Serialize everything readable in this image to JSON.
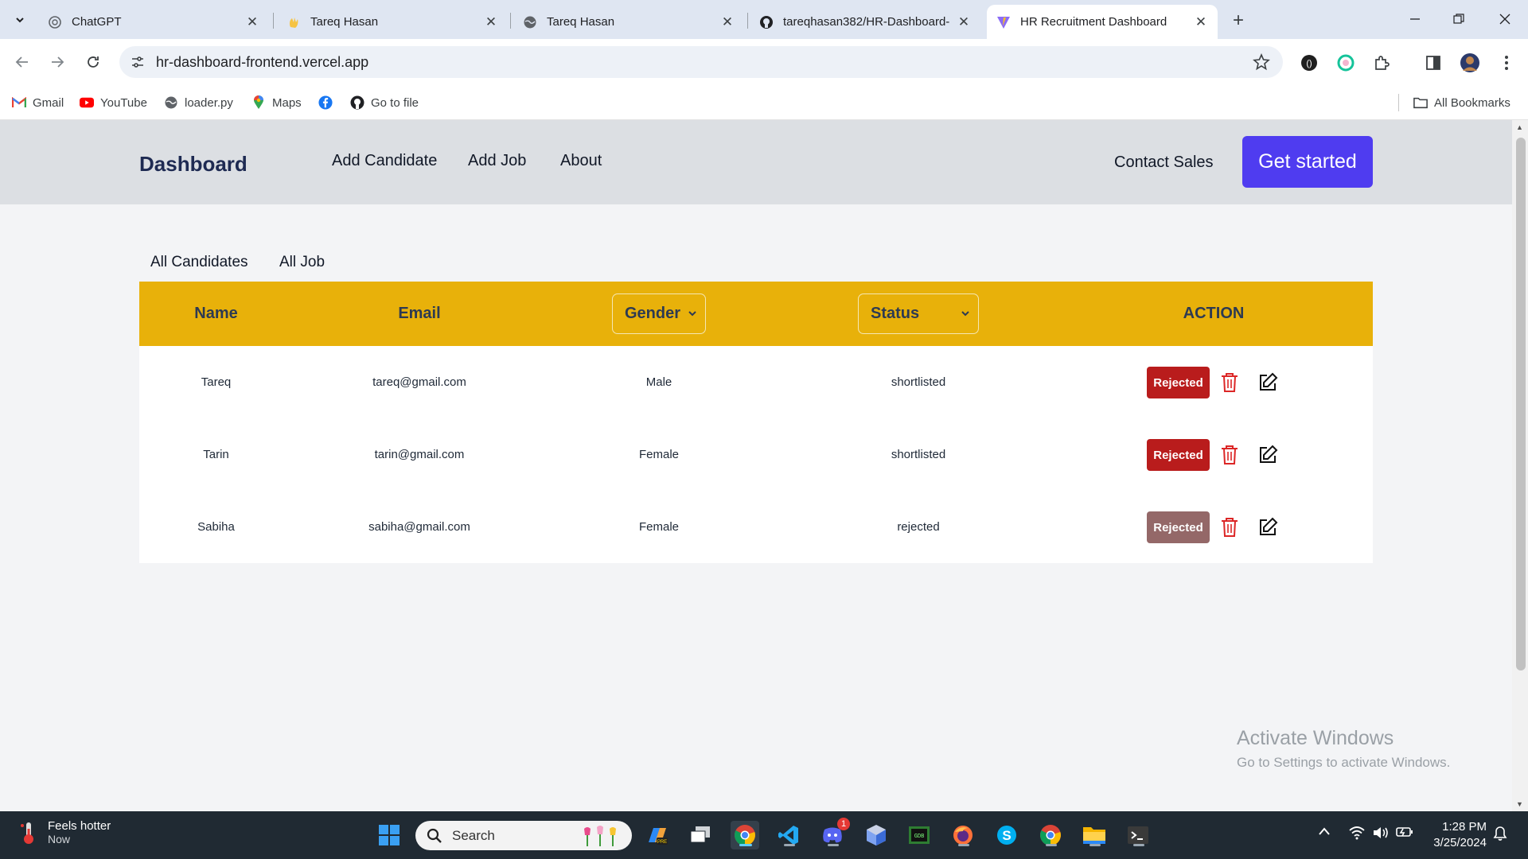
{
  "browser": {
    "tabs": [
      {
        "title": "ChatGPT",
        "icon": "chatgpt-icon",
        "active": false
      },
      {
        "title": "Tareq Hasan",
        "icon": "wave-hand-icon",
        "active": false
      },
      {
        "title": "Tareq Hasan",
        "icon": "globe-icon",
        "active": false
      },
      {
        "title": "tareqhasan382/HR-Dashboard-",
        "icon": "github-icon",
        "active": false
      },
      {
        "title": "HR Recruitment Dashboard",
        "icon": "vite-icon",
        "active": true
      }
    ],
    "url": "hr-dashboard-frontend.vercel.app",
    "bookmarks": [
      {
        "label": "Gmail",
        "icon": "gmail-icon"
      },
      {
        "label": "YouTube",
        "icon": "youtube-icon"
      },
      {
        "label": "loader.py",
        "icon": "globe-icon"
      },
      {
        "label": "Maps",
        "icon": "maps-icon"
      },
      {
        "label": "",
        "icon": "facebook-icon"
      },
      {
        "label": "Go to file",
        "icon": "github-icon"
      }
    ],
    "all_bookmarks": "All Bookmarks"
  },
  "nav": {
    "brand": "Dashboard",
    "links": [
      "Add Candidate",
      "Add Job",
      "About"
    ],
    "contact": "Contact Sales",
    "cta": "Get started"
  },
  "subtabs": [
    "All Candidates",
    "All Job"
  ],
  "table": {
    "headers": {
      "name": "Name",
      "email": "Email",
      "gender": "Gender",
      "status": "Status",
      "action": "ACTION"
    },
    "rows": [
      {
        "name": "Tareq",
        "email": "tareq@gmail.com",
        "gender": "Male",
        "status": "shortlisted",
        "action_label": "Rejected"
      },
      {
        "name": "Tarin",
        "email": "tarin@gmail.com",
        "gender": "Female",
        "status": "shortlisted",
        "action_label": "Rejected"
      },
      {
        "name": "Sabiha",
        "email": "sabiha@gmail.com",
        "gender": "Female",
        "status": "rejected",
        "action_label": "Rejected"
      }
    ]
  },
  "watermark": {
    "line1": "Activate Windows",
    "line2": "Go to Settings to activate Windows."
  },
  "taskbar": {
    "weather_title": "Feels hotter",
    "weather_sub": "Now",
    "search_label": "Search",
    "discord_badge": "1",
    "time": "1:28 PM",
    "date": "3/25/2024"
  },
  "colors": {
    "header_bg": "#e8b10a",
    "cta_bg": "#4f3cf0",
    "reject_bg": "#b91c1c",
    "reject_disabled_bg": "#946868",
    "nav_bg": "#dcdfe3"
  }
}
